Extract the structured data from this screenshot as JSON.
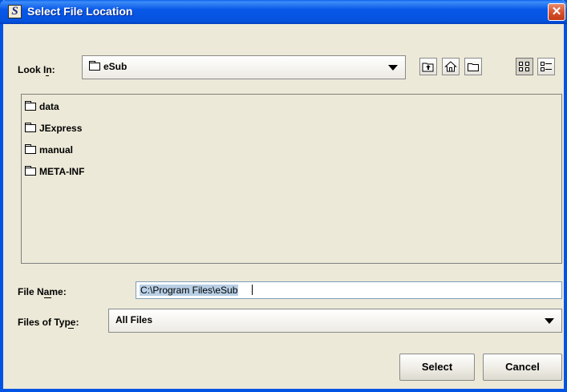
{
  "window": {
    "app_icon": "S",
    "title": "Select File Location",
    "close_glyph": "✕"
  },
  "look_in": {
    "label": "Look In:",
    "mnemonic": "I",
    "value": "eSub"
  },
  "toolbar": {
    "buttons": [
      {
        "name": "up-one-level",
        "icon": "up-folder-icon"
      },
      {
        "name": "home",
        "icon": "home-icon"
      },
      {
        "name": "new-folder",
        "icon": "new-folder-icon"
      },
      {
        "name": "list-view",
        "icon": "list-view-icon",
        "pressed": true
      },
      {
        "name": "details-view",
        "icon": "details-view-icon",
        "pressed": false
      }
    ]
  },
  "files": [
    {
      "name": "data",
      "type": "folder"
    },
    {
      "name": "JExpress",
      "type": "folder"
    },
    {
      "name": "manual",
      "type": "folder"
    },
    {
      "name": "META-INF",
      "type": "folder"
    }
  ],
  "file_name": {
    "label": "File Name:",
    "mnemonic": "N",
    "value": "C:\\Program Files\\eSub"
  },
  "files_of_type": {
    "label": "Files of Type:",
    "mnemonic": "T",
    "value": "All Files"
  },
  "buttons": {
    "select": "Select",
    "cancel": "Cancel"
  },
  "colors": {
    "titlebar": "#0858e8",
    "dialog_bg": "#ece9d8",
    "selection": "#b8cfe5",
    "close_button": "#d8532e"
  }
}
